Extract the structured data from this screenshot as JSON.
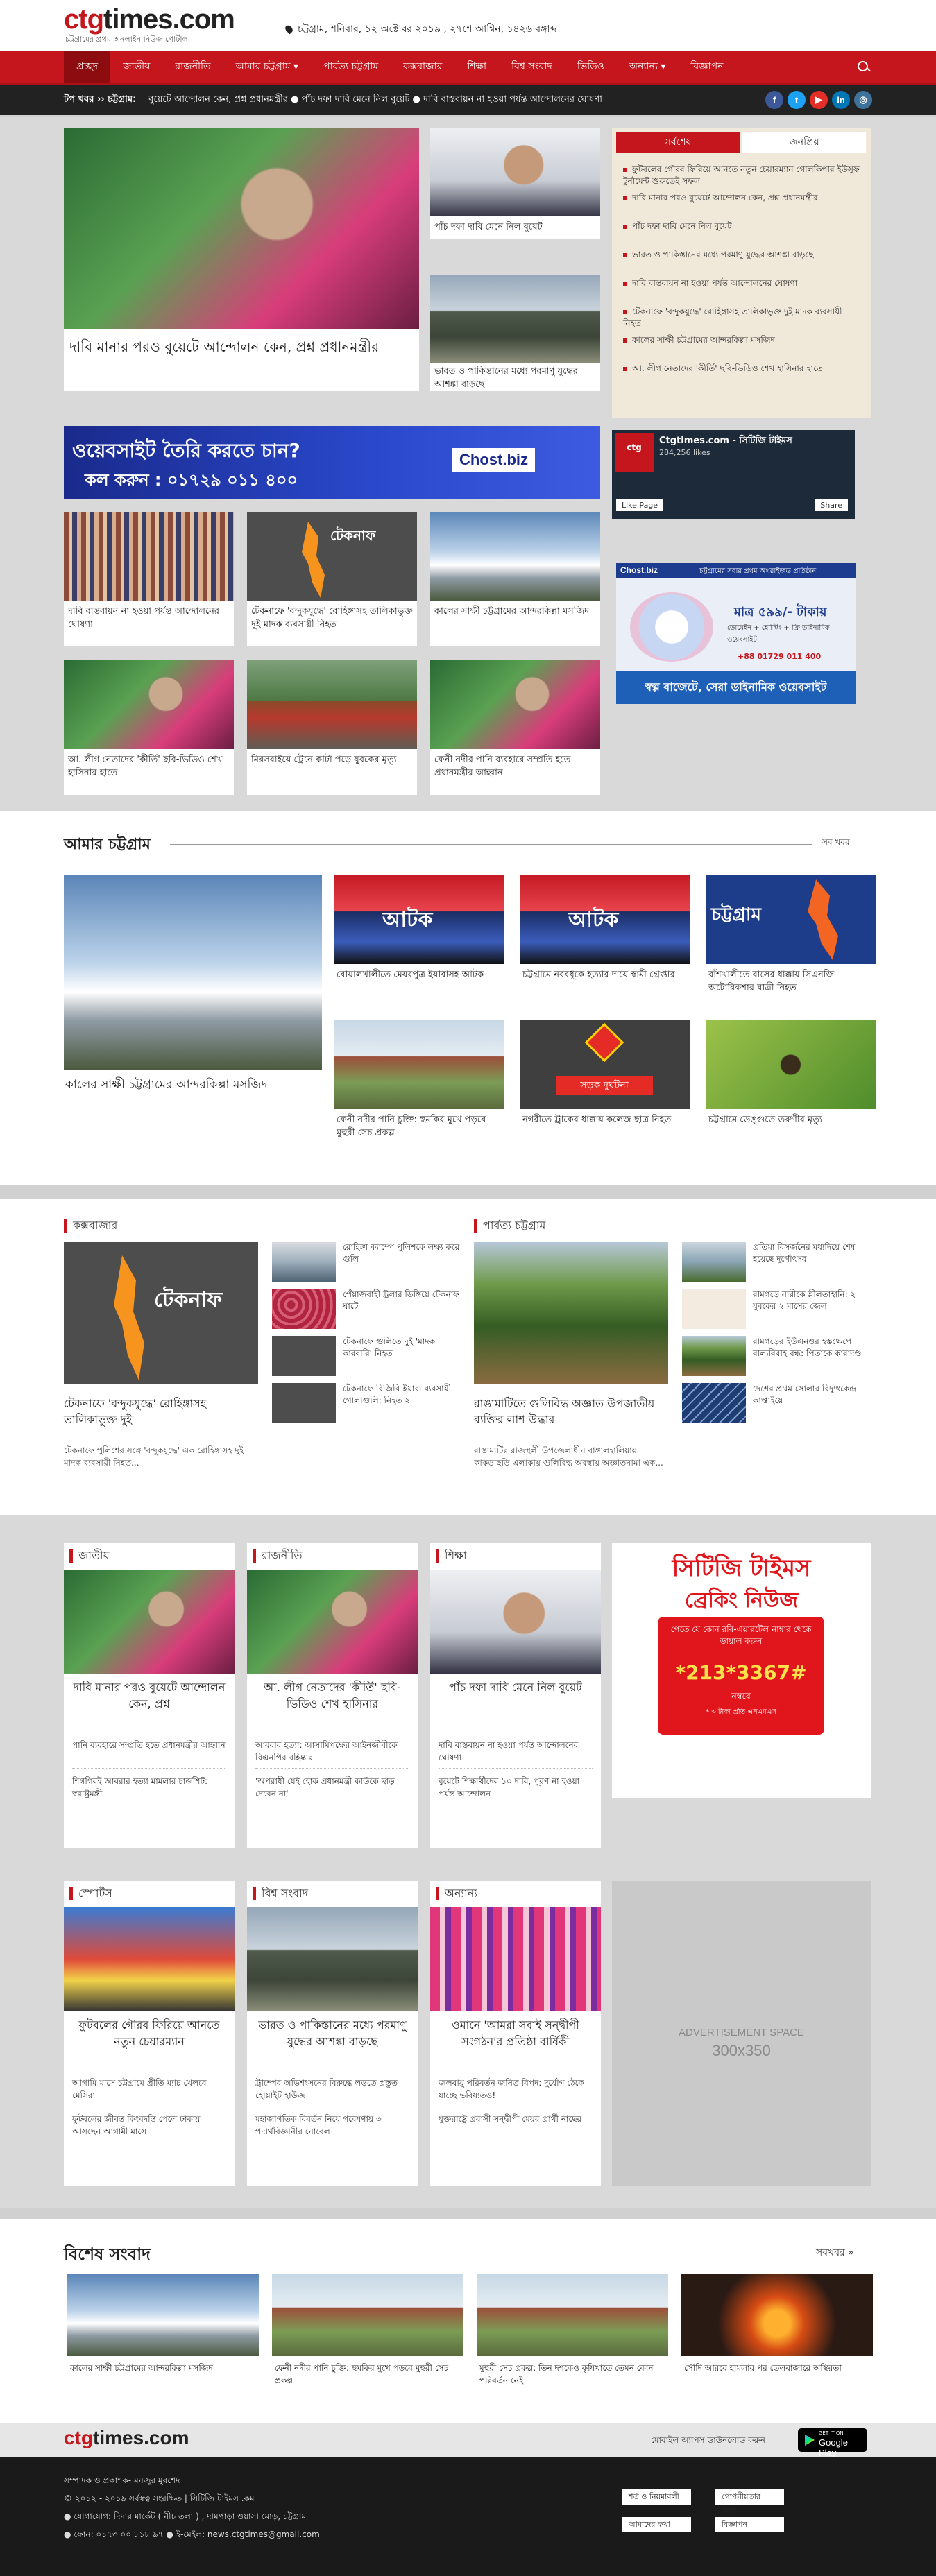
{
  "site": {
    "logo_ctg": "ctg",
    "logo_rest": "times.com",
    "tagline": "চট্টগ্রামের প্রথম অনলাইন নিউজ পোর্টাল",
    "date": "চট্টগ্রাম, শনিবার, ১২ অক্টোবর ২০১৯ , ২৭শে আশ্বিন, ১৪২৬ বঙ্গাব্দ"
  },
  "nav": [
    "প্রচ্ছদ",
    "জাতীয়",
    "রাজনীতি",
    "আমার চট্টগ্রাম ▾",
    "পার্বত্য চট্টগ্রাম",
    "কক্সবাজার",
    "শিক্ষা",
    "বিশ্ব সংবাদ",
    "ভিডিও",
    "অন্যান্য ▾",
    "বিজ্ঞাপন"
  ],
  "ticker": {
    "label": "টপ খবর ›› চট্টগ্রাম:",
    "text": "বুয়েটে আন্দোলন কেন, প্রশ্ন প্রধানমন্ত্রীর ● পাঁচ দফা দাবি মেনে নিল বুয়েট ● দাবি বাস্তবায়ন না হওয়া পর্যন্ত আন্দোলনের ঘোষণা"
  },
  "social_icons": [
    {
      "icon": "facebook-icon",
      "glyph": "f",
      "color": "#3b5998"
    },
    {
      "icon": "twitter-icon",
      "glyph": "t",
      "color": "#1da1f2"
    },
    {
      "icon": "youtube-icon",
      "glyph": "▶",
      "color": "#e52d27"
    },
    {
      "icon": "linkedin-icon",
      "glyph": "in",
      "color": "#0077b5"
    },
    {
      "icon": "instagram-icon",
      "glyph": "◎",
      "color": "#3f729b"
    }
  ],
  "lead": {
    "main": "দাবি মানার পরও বুয়েটে আন্দোলন কেন, প্রশ্ন প্রধানমন্ত্রীর",
    "side1": "পাঁচ দফা দাবি মেনে নিল বুয়েট",
    "side2": "ভারত ও পাকিস্তানের মধ্যে পরমাণু যুদ্ধের আশঙ্কা বাড়ছে"
  },
  "sidebar_tabs": [
    "সর্বশেষ",
    "জনপ্রিয়"
  ],
  "latest": [
    "ফুটবলের গৌরব ফিরিয়ে আনতে নতুন চেয়ারম্যান গোলকিপার ইউসুফ টুর্নামেন্ট শুরুতেই সফল",
    "দাবি মানার পরও বুয়েটে আন্দোলন কেন, প্রশ্ন প্রধানমন্ত্রীর",
    "পাঁচ দফা দাবি মেনে নিল বুয়েট",
    "ভারত ও পাকিস্তানের মধ্যে পরমাণু যুদ্ধের আশঙ্কা বাড়ছে",
    "দাবি বাস্তবায়ন না হওয়া পর্যন্ত আন্দোলনের ঘোষণা",
    "টেকনাফে 'বন্দুকযুদ্ধে' রোহিঙ্গাসহ তালিকাভুক্ত দুই মাদক ব্যবসায়ী নিহত",
    "কালের সাক্ষী চট্টগ্রামের আন্দরকিল্লা মসজিদ",
    "আ. লীগ নেতাদের 'কীর্তি' ছবি-ভিডিও শেখ হাসিনার হাতে"
  ],
  "hosting_ad": {
    "line1": "ওয়েবসাইট তৈরি করতে চান?",
    "line2": "কল করুন : ০১৭২৯ ০১১ ৪০০",
    "brand": "Chost.biz"
  },
  "fb_widget": {
    "title": "Ctgtimes.com - সিটিজি টাইমস",
    "likes": "284,256 likes",
    "like": "Like Page",
    "share": "Share"
  },
  "hosting_ad2": {
    "brand": "Chost.biz",
    "tagline": "চট্টগ্রামের সবার প্রথম অথরাইজড প্রতিষ্ঠান",
    "price": "মাত্র ৫৯৯/- টাকায়",
    "sub": "ডোমেইন + হোস্টিং + ফ্রি ডাইনামিক ওয়েবসাইট",
    "phone": "+88 01729 011 400",
    "footer": "স্বল্প বাজেটে, সেরা ডাইনামিক ওয়েবসাইট"
  },
  "grid": [
    "দাবি বাস্তবায়ন না হওয়া পর্যন্ত আন্দোলনের ঘোষণা",
    "টেকনাফে 'বন্দুকযুদ্ধে' রোহিঙ্গাসহ তালিকাভুক্ত দুই মাদক ব্যবসায়ী নিহত",
    "কালের সাক্ষী চট্টগ্রামের আন্দরকিল্লা মসজিদ",
    "আ. লীগ নেতাদের 'কীর্তি' ছবি-ভিডিও শেখ হাসিনার হাতে",
    "মিরসরাইয়ে ট্রেনে কাটা পড়ে যুবকের মৃত্যু",
    "ফেনী নদীর পানি ব্যবহারে সম্প্রতি হতে প্রধানমন্ত্রীর আহ্বান"
  ],
  "teknaf_label": "টেকনাফ",
  "amar_ctg": {
    "title": "আমার চট্টগ্রাম",
    "see_all": "সব খবর",
    "main": "কালের সাক্ষী চট্টগ্রামের আন্দরকিল্লা মসজিদ",
    "items": [
      "বোয়ালখালীতে মেয়রপুত্র ইয়াবাসহ আটক",
      "চট্টগ্রামে নববধূকে হত্যার দায়ে স্বামী গ্রেপ্তার",
      "বাঁশখালীতে বাসের ধাক্কায় সিএনজি অটোরিকশার যাত্রী নিহত",
      "ফেনী নদীর পানি চুক্তি: হুমকির মুখে পড়বে মুহুরী সেচ প্রকল্প",
      "নগরীতে ট্রাকের ধাক্কায় কলেজ ছাত্র নিহত",
      "চট্টগ্রামে ডেঙ্গুতে তরুণীর মৃত্যু"
    ],
    "labels": {
      "police": "আটক",
      "ctg": "চট্টগ্রাম",
      "accident": "সড়ক দুর্ঘটনা"
    }
  },
  "coxs": {
    "title": "কক্সবাজার",
    "main": "টেকনাফে 'বন্দুকযুদ্ধে' রোহিঙ্গাসহ তালিকাভুক্ত দুই",
    "main_sub": "টেকনাফে পুলিশের সঙ্গে 'বন্দুকযুদ্ধে' এক রোহিঙ্গাসহ দুই মাদক ব্যবসায়ী নিহত...",
    "items": [
      "রোহিঙ্গা ক্যাম্পে পুলিশকে লক্ষ্য করে গুলি",
      "পেঁয়াজবাহী ট্রলার ডিঙ্গিয়ে টেকনাফ ঘাটে",
      "টেকনাফে গুলিতে দুই 'মাদক কারবারি' নিহত",
      "টেকনাফে বিজিবি-ইয়াবা ব্যবসায়ী গোলাগুলি: নিহত ২"
    ]
  },
  "hill": {
    "title": "পার্বত্য চট্টগ্রাম",
    "main": "রাঙামাটিতে গুলিবিদ্ধ অজ্ঞাত উপজাতীয় ব্যক্তির লাশ উদ্ধার",
    "main_sub": "রাঙামাটির রাজস্থলী উপজেলাধীন বাঙ্গালহালিয়ায় কাকড়াছড়ি এলাকায় গুলিবিদ্ধ অবস্থায় অজ্ঞাতনামা এক...",
    "items": [
      "প্রতিমা বিসর্জনের মধ্যদিয়ে শেষ হয়েছে দুর্গোৎসব",
      "রামগড়ে নারীকে শ্লীলতাহানি: ২ যুবকের ২ মাসের জেল",
      "রামগড়ের ইউএনওর হস্তক্ষেপে বাল্যবিবাহ বন্ধ: পিতাকে কারাদণ্ড",
      "দেশের প্রথম সোলার বিদ্যুৎকেন্দ্র কাপ্তাইয়ে"
    ]
  },
  "cats1": [
    {
      "title": "জাতীয়",
      "head": "দাবি মানার পরও বুয়েটে আন্দোলন কেন, প্রশ্ন",
      "l1": "পানি ব্যবহারে সম্প্রতি হতে প্রধানমন্ত্রীর আহ্বান",
      "l2": "শিগগিরই আবরার হত্যা মামলার চার্জশিট: স্বরাষ্ট্রমন্ত্রী"
    },
    {
      "title": "রাজনীতি",
      "head": "আ. লীগ নেতাদের 'কীর্তি' ছবি-ভিডিও শেখ হাসিনার",
      "l1": "আবরার হত্যা: আসামিপক্ষের আইনজীবীকে বিএনপির বহিষ্কার",
      "l2": "'অপরাধী যেই হোক প্রধানমন্ত্রী কাউকে ছাড় দেবেন না'"
    },
    {
      "title": "শিক্ষা",
      "head": "পাঁচ দফা দাবি মেনে নিল বুয়েট",
      "l1": "দাবি বাস্তবায়ন না হওয়া পর্যন্ত আন্দোলনের ঘোষণা",
      "l2": "বুয়েটে শিক্ষার্থীদের ১০ দাবি, পূরণ না হওয়া পর্যন্ত আন্দোলন"
    }
  ],
  "breaking_ad": {
    "line1": "সিটিজি টাইমস",
    "line2": "ব্রেকিং নিউজ",
    "line3": "পেতে যে কোন রবি-এয়ারটেল নাম্বার থেকে ডায়াল করুন",
    "code": "*213*3367#",
    "line4": "নম্বরে",
    "line5": "* ৩ টাকা প্রতি এসএমএস"
  },
  "cats2": [
    {
      "title": "স্পোর্টস",
      "head": "ফুটবলের গৌরব ফিরিয়ে আনতে নতুন চেয়ারম্যান",
      "l1": "আগামি মাসে চট্টগ্রামে প্রীতি ম্যাচ খেলবে মেসিরা",
      "l2": "ফুটবলের জীবন্ত কিংবদন্তি পেলে ঢাকায় আসছেন আগামী মাসে"
    },
    {
      "title": "বিশ্ব সংবাদ",
      "head": "ভারত ও পাকিস্তানের মধ্যে পরমাণু যুদ্ধের আশঙ্কা বাড়ছে",
      "l1": "ট্রাম্পের অভিশংসনের বিরুদ্ধে লড়তে প্রস্তুত হোয়াইট হাউজ",
      "l2": "মহাজাগতিক বিবর্তন নিয়ে গবেষণায় ৩ পদার্থবিজ্ঞানীর নোবেল"
    },
    {
      "title": "অন্যান্য",
      "head": "ওমানে 'আমরা সবাই সন্দ্বীপী সংগঠন'র প্রতিষ্ঠা বার্ষিকী",
      "l1": "জলবায়ু পরিবর্তন জনিত বিপদ: দুর্যোগ ঠেকে যাচ্ছে ভবিষ্যতও!",
      "l2": "যুক্তরাষ্ট্রে প্রবাসী সন্দ্বীপী মেয়র প্রার্থী নাছের"
    }
  ],
  "ad_space": {
    "line1": "ADVERTISEMENT SPACE",
    "line2": "300x350"
  },
  "special": {
    "title": "বিশেষ সংবাদ",
    "see_all": "সবখবর »",
    "items": [
      "কালের সাক্ষী চট্টগ্রামের আন্দরকিল্লা মসজিদ",
      "ফেনী নদীর পানি চুক্তি: হুমকির মুখে পড়বে মুহুরী সেচ প্রকল্প",
      "মুহুরী সেচ প্রকল্প: তিন দশকেও কৃষিখাতে তেমন কোন পরিবর্তন নেই",
      "সৌদি আরবে হামলার পর তেলবাজারে অস্থিরতা"
    ]
  },
  "app_bar": {
    "text": "মোবাইল অ্যাপস ডাউনলোড করুন",
    "store": "Google Play",
    "store_small": "GET IT ON"
  },
  "footer": {
    "editor": "সম্পাদক ও প্রকাশক- মনজুর মুরশেদ",
    "copyright": "© ২০১২ - ২০১৯ সর্বস্বত্ব সংরক্ষিত | সিটিজি টাইমস .কম",
    "address": "● যোগাযোগ: দিদার মার্কেট ( নীচ তলা ) , দামপাড়া ওয়াসা মোড়, চট্টগ্রাম",
    "contact": "● ফোন: ০১৭৩ ০০ ৮১৮ ৯৭ ● ই-মেইল: news.ctgtimes@gmail.com",
    "links": [
      "শর্ত ও নিয়মাবলী",
      "গোপনীয়তার নীতি",
      "আমাদের কথা",
      "বিজ্ঞাপন"
    ]
  }
}
